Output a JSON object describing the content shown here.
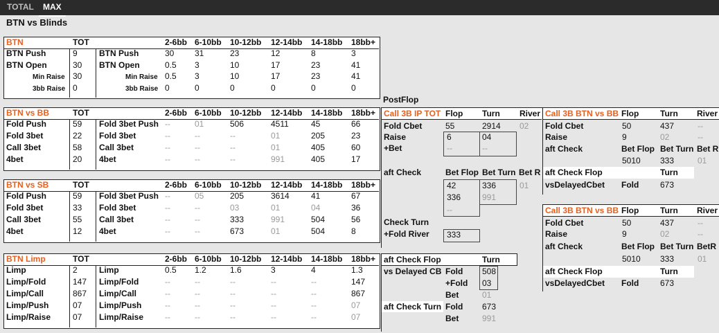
{
  "tabs": {
    "total": "TOTAL",
    "max": "MAX"
  },
  "title": "BTN vs Blinds",
  "postflop": "PostFlop",
  "cols": {
    "tot": "TOT",
    "c1": "2-6bb",
    "c2": "6-10bb",
    "c3": "10-12bb",
    "c4": "12-14bb",
    "c5": "14-18bb",
    "c6": "18bb+"
  },
  "btn": {
    "header": "BTN",
    "rows": [
      {
        "label": "BTN Push",
        "tot": "9",
        "label2": "BTN Push",
        "v": [
          "30",
          "31",
          "23",
          "12",
          "8",
          "3"
        ]
      },
      {
        "label": "BTN Open",
        "tot": "30",
        "label2": "BTN Open",
        "v": [
          "0.5",
          "3",
          "10",
          "17",
          "23",
          "41"
        ]
      },
      {
        "label": "Min Raise",
        "tot": "30",
        "label2": "Min Raise",
        "v": [
          "0.5",
          "3",
          "10",
          "17",
          "23",
          "41"
        ]
      },
      {
        "label": "3bb Raise",
        "tot": "0",
        "label2": "3bb Raise",
        "v": [
          "0",
          "0",
          "0",
          "0",
          "0",
          "0"
        ]
      }
    ]
  },
  "vsbb": {
    "header": "BTN vs BB",
    "rows": [
      {
        "label": "Fold Push",
        "tot": "59",
        "label2": "Fold 3bet Push",
        "v": [
          "--",
          "01",
          "506",
          "4511",
          "45",
          "66"
        ]
      },
      {
        "label": "Fold 3bet",
        "tot": "22",
        "label2": "Fold 3bet",
        "v": [
          "--",
          "--",
          "--",
          "01",
          "205",
          "23"
        ]
      },
      {
        "label": "Call 3bet",
        "tot": "58",
        "label2": "Call 3bet",
        "v": [
          "--",
          "--",
          "--",
          "01",
          "405",
          "60"
        ]
      },
      {
        "label": "4bet",
        "tot": "20",
        "label2": "4bet",
        "v": [
          "--",
          "--",
          "--",
          "991",
          "405",
          "17"
        ]
      }
    ]
  },
  "vssb": {
    "header": "BTN vs SB",
    "rows": [
      {
        "label": "Fold Push",
        "tot": "59",
        "label2": "Fold 3bet Push",
        "v": [
          "--",
          "05",
          "205",
          "3614",
          "41",
          "67"
        ]
      },
      {
        "label": "Fold 3bet",
        "tot": "33",
        "label2": "Fold 3bet",
        "v": [
          "--",
          "--",
          "03",
          "01",
          "04",
          "36"
        ]
      },
      {
        "label": "Call 3bet",
        "tot": "55",
        "label2": "Call 3bet",
        "v": [
          "--",
          "--",
          "333",
          "991",
          "504",
          "56"
        ]
      },
      {
        "label": "4bet",
        "tot": "12",
        "label2": "4bet",
        "v": [
          "--",
          "--",
          "673",
          "01",
          "504",
          "8"
        ]
      }
    ]
  },
  "limp": {
    "header": "BTN Limp",
    "rows": [
      {
        "label": "Limp",
        "tot": "2",
        "label2": "Limp",
        "v": [
          "0.5",
          "1.2",
          "1.6",
          "3",
          "4",
          "1.3"
        ]
      },
      {
        "label": "Limp/Fold",
        "tot": "147",
        "label2": "Limp/Fold",
        "v": [
          "--",
          "--",
          "--",
          "--",
          "--",
          "147"
        ]
      },
      {
        "label": "Limp/Call",
        "tot": "867",
        "label2": "Limp/Call",
        "v": [
          "--",
          "--",
          "--",
          "--",
          "--",
          "867"
        ]
      },
      {
        "label": "Limp/Push",
        "tot": "07",
        "label2": "Limp/Push",
        "v": [
          "--",
          "--",
          "--",
          "--",
          "--",
          "07"
        ]
      },
      {
        "label": "Limp/Raise",
        "tot": "07",
        "label2": "Limp/Raise",
        "v": [
          "--",
          "--",
          "--",
          "--",
          "--",
          "07"
        ]
      }
    ]
  },
  "c3bip": {
    "header": "Call 3B IP TOT",
    "flop": "Flop",
    "turn": "Turn",
    "river": "River",
    "fold_cbet": "Fold Cbet",
    "fc_flop": "55",
    "fc_turn": "2914",
    "fc_river": "02",
    "raise": "Raise",
    "raise_flop": "6",
    "raise_turn": "04",
    "plus_bet": "+Bet",
    "pb_flop": "--",
    "pb_turn": "--",
    "aft_check": "aft Check",
    "bet_flop": "Bet Flop",
    "bet_turn": "Bet Turn",
    "bet_r": "Bet R",
    "ac_r1_flop": "42",
    "ac_r1_turn": "336",
    "ac_r1_river": "01",
    "ac_r2_flop": "336",
    "ac_r2_turn": "991",
    "ac_r3_flop": "--",
    "check_turn": "Check Turn",
    "fold_river": "+Fold River",
    "fold_river_val": "333",
    "aft_check_flop": "aft Check Flop",
    "acf_turn": "Turn",
    "vs_delayed": "vs Delayed CB",
    "vd_fold": "Fold",
    "vd_fold_val": "508",
    "vd_plus_fold": "+Fold",
    "vd_plus_fold_val": "03",
    "vd_bet": "Bet",
    "vd_bet_val": "01",
    "aft_check_turn": "aft Check Turn",
    "act_fold": "Fold",
    "act_fold_val": "673",
    "act_bet": "Bet",
    "act_bet_val": "991"
  },
  "c3bb1": {
    "header": "Call 3B BTN vs BB",
    "flop": "Flop",
    "turn": "Turn",
    "river": "River",
    "fold_cbet": "Fold Cbet",
    "fc_flop": "50",
    "fc_turn": "437",
    "fc_river": "--",
    "raise": "Raise",
    "raise_flop": "9",
    "raise_turn": "02",
    "raise_river": "--",
    "aft_check": "aft Check",
    "bet_flop": "Bet Flop",
    "bet_turn": "Bet Turn",
    "bet_r": "Bet R",
    "ac_flop": "5010",
    "ac_turn": "333",
    "ac_river": "01",
    "aft_check_flop": "aft Check Flop",
    "acf_turn": "Turn",
    "vs_delayed": "vsDelayedCbet",
    "vd_fold": "Fold",
    "vd_fold_val": "673"
  },
  "c3bb2": {
    "header": "Call 3B BTN vs BB",
    "flop": "Flop",
    "turn": "Turn",
    "river": "River",
    "fold_cbet": "Fold Cbet",
    "fc_flop": "50",
    "fc_turn": "437",
    "fc_river": "--",
    "raise": "Raise",
    "raise_flop": "9",
    "raise_turn": "02",
    "raise_river": "--",
    "aft_check": "aft Check",
    "bet_flop": "Bet Flop",
    "bet_turn": "Bet Turn",
    "bet_r": "BetR",
    "ac_flop": "5010",
    "ac_turn": "333",
    "ac_river": "01",
    "aft_check_flop": "aft Check Flop",
    "acf_turn": "Turn",
    "vs_delayed": "vsDelayedCbet",
    "vd_fold": "Fold",
    "vd_fold_val": "673"
  }
}
